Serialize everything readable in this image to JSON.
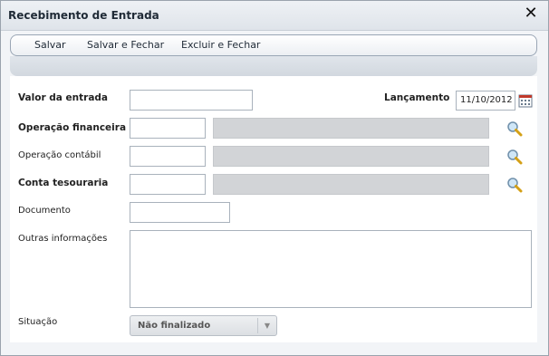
{
  "dialog": {
    "title": "Recebimento de Entrada",
    "close_label": "✕"
  },
  "toolbar": {
    "save_label": "Salvar",
    "save_close_label": "Salvar e Fechar",
    "delete_close_label": "Excluir e Fechar"
  },
  "form": {
    "valor_entrada": {
      "label": "Valor da entrada",
      "value": ""
    },
    "lancamento": {
      "label": "Lançamento",
      "value": "11/10/2012"
    },
    "operacao_financeira": {
      "label": "Operação financeira",
      "code": "",
      "description": ""
    },
    "operacao_contabil": {
      "label": "Operação contábil",
      "code": "",
      "description": ""
    },
    "conta_tesouraria": {
      "label": "Conta tesouraria",
      "code": "",
      "description": ""
    },
    "documento": {
      "label": "Documento",
      "value": ""
    },
    "outras_informacoes": {
      "label": "Outras informações",
      "value": ""
    },
    "situacao": {
      "label": "Situação",
      "value": "Não finalizado"
    }
  },
  "icons": {
    "lookup": "magnifier-icon",
    "calendar": "calendar-icon",
    "close": "close-icon"
  }
}
